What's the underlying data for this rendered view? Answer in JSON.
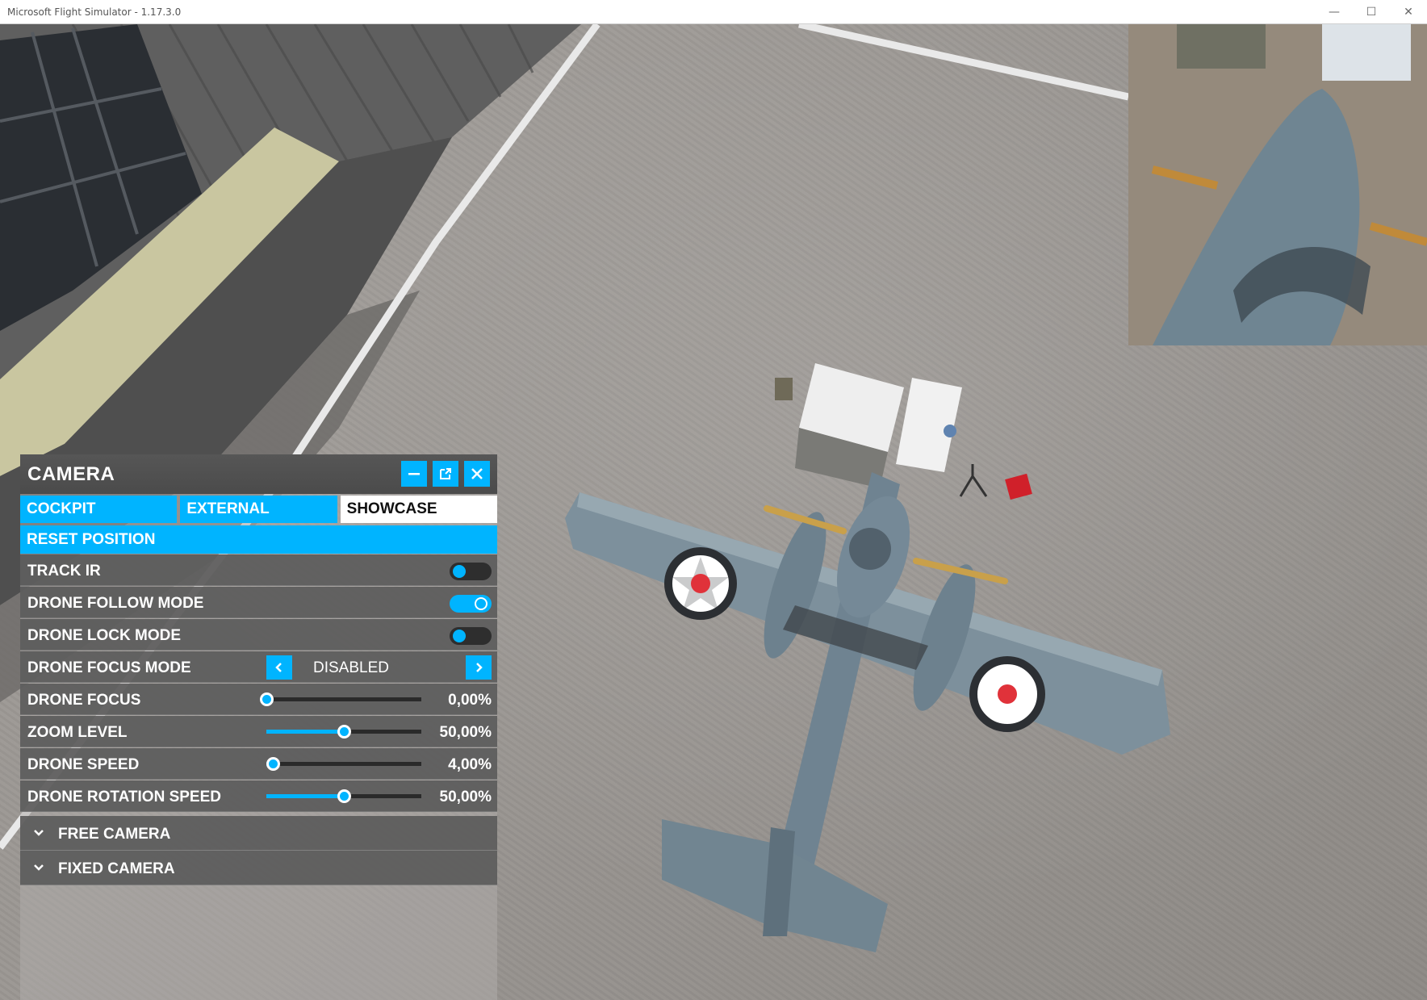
{
  "window": {
    "title": "Microsoft Flight Simulator - 1.17.3.0",
    "controls": {
      "minimize": "—",
      "maximize": "☐",
      "close": "✕"
    }
  },
  "camera_panel": {
    "title": "CAMERA",
    "header_buttons": [
      "minimize-icon",
      "pop-out-icon",
      "close-icon"
    ],
    "tabs": [
      {
        "label": "COCKPIT",
        "active": false
      },
      {
        "label": "EXTERNAL",
        "active": false
      },
      {
        "label": "SHOWCASE",
        "active": true
      }
    ],
    "reset_label": "RESET POSITION",
    "toggles": [
      {
        "label": "TRACK IR",
        "on": false
      },
      {
        "label": "DRONE FOLLOW MODE",
        "on": true
      },
      {
        "label": "DRONE LOCK MODE",
        "on": false
      }
    ],
    "focus_mode": {
      "label": "DRONE FOCUS MODE",
      "value": "DISABLED"
    },
    "sliders": [
      {
        "label": "DRONE FOCUS",
        "value": "0,00%",
        "fraction": 0.0
      },
      {
        "label": "ZOOM LEVEL",
        "value": "50,00%",
        "fraction": 0.5
      },
      {
        "label": "DRONE SPEED",
        "value": "4,00%",
        "fraction": 0.04
      },
      {
        "label": "DRONE ROTATION SPEED",
        "value": "50,00%",
        "fraction": 0.5
      }
    ],
    "sections": [
      {
        "label": "FREE CAMERA"
      },
      {
        "label": "FIXED CAMERA"
      }
    ]
  },
  "colors": {
    "accent": "#00b4ff",
    "panel_row": "#585858",
    "aircraft": "#7b8f9c",
    "roundel_red": "#e0323a"
  }
}
